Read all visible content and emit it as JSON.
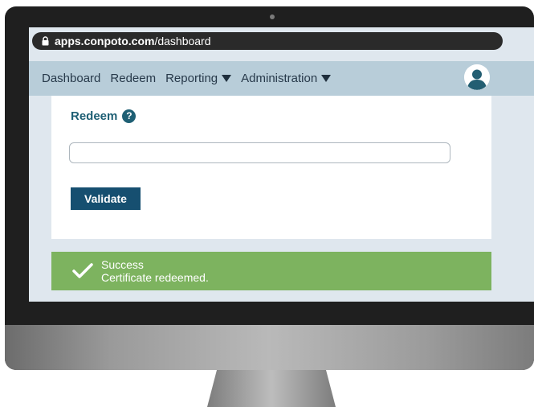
{
  "browser": {
    "url_domain": "apps.conpoto.com",
    "url_path": "/dashboard",
    "icons": {
      "lock": "lock-icon"
    }
  },
  "nav": {
    "items": [
      {
        "label": "Dashboard",
        "has_dropdown": false
      },
      {
        "label": "Redeem",
        "has_dropdown": false
      },
      {
        "label": "Reporting",
        "has_dropdown": true
      },
      {
        "label": "Administration",
        "has_dropdown": true
      }
    ],
    "icons": {
      "dropdown": "caret-down-icon",
      "user": "user-avatar-icon"
    }
  },
  "redeem": {
    "title": "Redeem",
    "help_glyph": "?",
    "input_value": "",
    "input_placeholder": "",
    "validate_label": "Validate"
  },
  "alert": {
    "title": "Success",
    "message": "Certificate redeemed.",
    "icon": "checkmark-icon"
  },
  "colors": {
    "nav_bg": "#b8cdd9",
    "brand_teal": "#1e5f74",
    "button_bg": "#164f70",
    "success_bg": "#7db35f",
    "screen_bg": "#dfe7ee"
  }
}
